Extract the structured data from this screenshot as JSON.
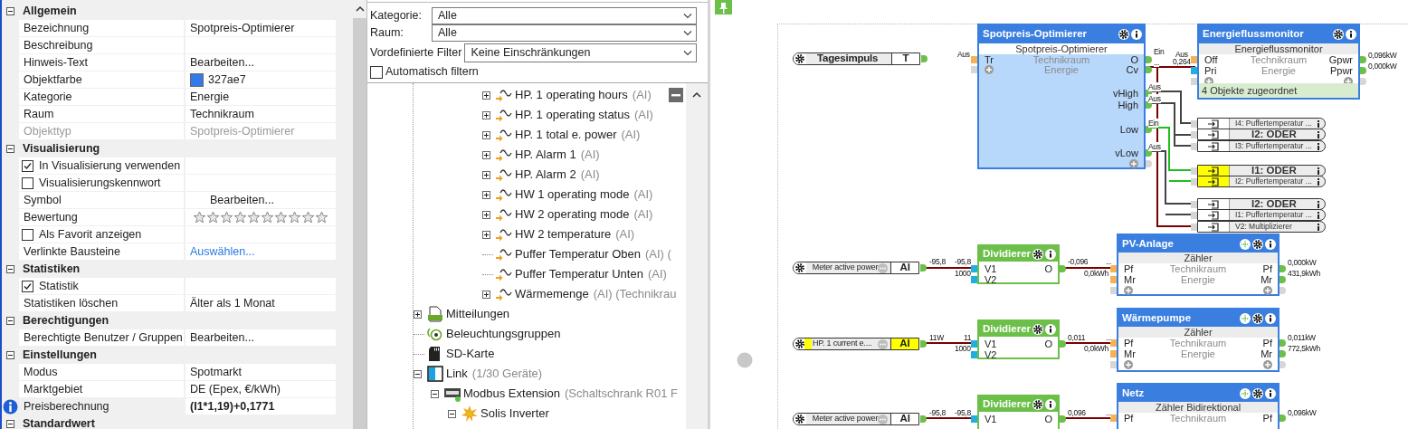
{
  "properties": {
    "sections": [
      {
        "title": "Allgemein",
        "expanded": true,
        "rows": [
          {
            "kind": "text",
            "label": "Bezeichnung",
            "value": "Spotpreis-Optimierer",
            "disabled": false
          },
          {
            "kind": "text",
            "label": "Beschreibung",
            "disabled": false
          },
          {
            "kind": "text",
            "label": "Hinweis-Text",
            "value": "Bearbeiten...",
            "disabled": false
          },
          {
            "kind": "color",
            "label": "Objektfarbe",
            "value": "327ae7",
            "color": "#327ae7",
            "disabled": false
          },
          {
            "kind": "text",
            "label": "Kategorie",
            "value": "Energie",
            "disabled": false
          },
          {
            "kind": "text",
            "label": "Raum",
            "value": "Technikraum",
            "disabled": false
          },
          {
            "kind": "text",
            "label": "Objekttyp",
            "value": "Spotpreis-Optimierer",
            "disabled": true
          }
        ]
      },
      {
        "title": "Visualisierung",
        "expanded": true,
        "rows": [
          {
            "kind": "check",
            "label": "In Visualisierung verwenden",
            "checked": true,
            "disabled": false
          },
          {
            "kind": "check",
            "label": "Visualisierungskennwort",
            "checked": false,
            "disabled": false
          },
          {
            "kind": "symbol",
            "label": "Symbol",
            "value": "Bearbeiten...",
            "disabled": false
          },
          {
            "kind": "stars",
            "label": "Bewertung",
            "stars": 0,
            "disabled": false
          },
          {
            "kind": "check",
            "label": "Als Favorit anzeigen",
            "checked": false,
            "disabled": false
          },
          {
            "kind": "link",
            "label": "Verlinkte Bausteine",
            "value": "Auswählen...",
            "disabled": false
          }
        ]
      },
      {
        "title": "Statistiken",
        "expanded": true,
        "rows": [
          {
            "kind": "check",
            "label": "Statistik",
            "checked": true,
            "disabled": false
          },
          {
            "kind": "text",
            "label": "Statistiken löschen",
            "value": "Älter als 1 Monat",
            "disabled": false
          }
        ]
      },
      {
        "title": "Berechtigungen",
        "expanded": true,
        "rows": [
          {
            "kind": "text",
            "label": "Berechtigte Benutzer / Gruppen",
            "value": "Bearbeiten...",
            "disabled": false
          }
        ]
      },
      {
        "title": "Einstellungen",
        "expanded": true,
        "rows": [
          {
            "kind": "text",
            "label": "Modus",
            "value": "Spotmarkt",
            "disabled": false
          },
          {
            "kind": "text",
            "label": "Marktgebiet",
            "value": "DE (Epex, €/kWh)",
            "disabled": false
          },
          {
            "kind": "formula",
            "label": "Preisberechnung",
            "value": "(I1*1,19)+0,1771",
            "disabled": false
          }
        ]
      },
      {
        "title": "Standardwert",
        "expanded": true
      }
    ]
  },
  "filter": {
    "category": {
      "label": "Kategorie:",
      "value": "Alle"
    },
    "room": {
      "label": "Raum:",
      "value": "Alle"
    },
    "preset": {
      "label": "Vordefinierte Filter",
      "value": "Keine Einschränkungen"
    },
    "auto_filter": {
      "label": "Automatisch filtern",
      "checked": false
    }
  },
  "tree": {
    "items": [
      {
        "kind": "continuation",
        "children": [
          {
            "kind": "continuation",
            "children": [
              {
                "kind": "continuation",
                "children": [
                  {
                    "kind": "continuation",
                    "children": [
                      {
                        "kind": "analog",
                        "label": "HP. 1 operating hours",
                        "suffix": "(AI)",
                        "expanded": false
                      },
                      {
                        "kind": "analog",
                        "label": "HP. 1 operating status",
                        "suffix": "(AI)",
                        "expanded": false
                      },
                      {
                        "kind": "analog",
                        "label": "HP. 1 total e. power",
                        "suffix": "(AI)",
                        "expanded": false
                      },
                      {
                        "kind": "analog",
                        "label": "HP. Alarm 1",
                        "suffix": "(AI)",
                        "expanded": false
                      },
                      {
                        "kind": "analog",
                        "label": "HP. Alarm 2",
                        "suffix": "(AI)",
                        "expanded": false
                      },
                      {
                        "kind": "analog",
                        "label": "HW 1 operating mode",
                        "suffix": "(AI)",
                        "expanded": false
                      },
                      {
                        "kind": "analog",
                        "label": "HW 2 operating mode",
                        "suffix": "(AI)",
                        "expanded": false
                      },
                      {
                        "kind": "analog",
                        "label": "HW 2 temperature",
                        "suffix": "(AI)",
                        "expanded": false
                      },
                      {
                        "kind": "analog",
                        "label": "Puffer Temperatur Oben",
                        "suffix": "(AI) ("
                      },
                      {
                        "kind": "analog",
                        "label": "Puffer Temperatur Unten",
                        "suffix": "(AI)"
                      },
                      {
                        "kind": "analog",
                        "label": "Wärmemenge",
                        "suffix": "(AI) (Technikrau",
                        "expanded": false
                      }
                    ]
                  }
                ]
              }
            ]
          }
        ]
      },
      {
        "kind": "log",
        "label": "Mitteilungen",
        "expanded": false
      },
      {
        "kind": "light",
        "label": "Beleuchtungsgruppen"
      },
      {
        "kind": "sd",
        "label": "SD-Karte"
      },
      {
        "kind": "link",
        "label": "Link",
        "suffix": "(1/30 Geräte)",
        "expanded": true,
        "children": [
          {
            "kind": "modbus",
            "label": "Modbus Extension",
            "suffix": "(Schaltschrank R01 F",
            "expanded": true,
            "children": [
              {
                "kind": "inverter",
                "label": "Solis Inverter",
                "expanded": true
              }
            ]
          }
        ]
      }
    ]
  },
  "canvas": {
    "inputs": [
      {
        "label": "Tagesimpuls",
        "type_label": "T",
        "has_options": false,
        "highlighted": false
      },
      {
        "label": "Meter active power",
        "type_label": "AI",
        "has_options": true,
        "highlighted": false
      },
      {
        "label": "HP. 1 current e....",
        "type_label": "AI",
        "has_options": true,
        "highlighted": true
      },
      {
        "label": "Meter active power",
        "type_label": "AI",
        "has_options": true,
        "highlighted": false
      }
    ],
    "blocks": [
      {
        "kind": "optimizer",
        "title": "Spotpreis-Optimierer",
        "subtitle": "Spotpreis-Optimierer",
        "rows": [
          {
            "left": "Tr",
            "center": "Technikraum",
            "right": "O",
            "input": {
              "kind": "trigger"
            },
            "output": {
              "kind": "value"
            }
          },
          {
            "input": {
              "kind": "add"
            },
            "center": "Energie",
            "right": "Cv",
            "output": {
              "kind": "value"
            }
          },
          {
            "right": "vHigh",
            "output": {
              "kind": "value"
            }
          },
          {
            "right": "High",
            "output": {
              "kind": "value"
            }
          },
          {
            "right": "Low",
            "output": {
              "kind": "value"
            }
          },
          {
            "right": "vLow",
            "output": {
              "kind": "value"
            }
          },
          {
            "output": {
              "kind": "add"
            }
          }
        ]
      },
      {
        "kind": "monitor",
        "title": "Energieflussmonitor",
        "subtitle": "Energieflussmonitor",
        "footer": "4 Objekte zugeordnet",
        "rows": [
          {
            "left": "Off",
            "center": "Technikraum",
            "right": "Gpwr",
            "input": {
              "kind": "trigger"
            },
            "output": {
              "kind": "value"
            }
          },
          {
            "left": "Pri",
            "center": "Energie",
            "right": "Ppwr",
            "input": {
              "kind": "value"
            },
            "output": {
              "kind": "value"
            }
          },
          {
            "input": {
              "kind": "add"
            },
            "output": {
              "kind": "add"
            }
          }
        ]
      },
      {
        "kind": "divider",
        "title": "Dividierer",
        "rows": [
          {
            "left": "V1",
            "right": "O",
            "input": {
              "kind": "value"
            },
            "output": {
              "kind": "value"
            }
          },
          {
            "left": "V2",
            "input": {
              "kind": "value"
            }
          }
        ]
      },
      {
        "kind": "meter",
        "title": "PV-Anlage",
        "subtitle": "Zähler",
        "rows": [
          {
            "left": "Pf",
            "center": "Technikraum",
            "right": "Pf",
            "input": {
              "kind": "trigger"
            },
            "output": {
              "kind": "value"
            }
          },
          {
            "left": "Mr",
            "center": "Energie",
            "right": "Mr",
            "input": {
              "kind": "trigger"
            },
            "output": {
              "kind": "value"
            }
          },
          {
            "input": {
              "kind": "add"
            },
            "output": {
              "kind": "add"
            }
          }
        ]
      },
      {
        "kind": "divider",
        "title": "Dividierer",
        "rows": [
          {
            "left": "V1",
            "right": "O",
            "input": {
              "kind": "value"
            },
            "output": {
              "kind": "value"
            }
          },
          {
            "left": "V2",
            "input": {
              "kind": "value"
            }
          }
        ]
      },
      {
        "kind": "meter",
        "title": "Wärmepumpe",
        "subtitle": "Zähler",
        "rows": [
          {
            "left": "Pf",
            "center": "Technikraum",
            "right": "Pf",
            "input": {
              "kind": "trigger"
            },
            "output": {
              "kind": "value"
            }
          },
          {
            "left": "Mr",
            "center": "Energie",
            "right": "Mr",
            "input": {
              "kind": "trigger"
            },
            "output": {
              "kind": "value"
            }
          },
          {
            "input": {
              "kind": "add"
            },
            "output": {
              "kind": "add"
            }
          }
        ]
      },
      {
        "kind": "divider",
        "title": "Dividierer",
        "rows": [
          {
            "left": "V1",
            "right": "O",
            "input": {
              "kind": "value"
            },
            "output": {
              "kind": "value"
            }
          }
        ]
      },
      {
        "kind": "meter",
        "title": "Netz",
        "subtitle": "Zähler Bidirektional",
        "rows": [
          {
            "left": "Pf",
            "center": "Technikraum",
            "right": "Pf",
            "input": {
              "kind": "trigger"
            },
            "output": {
              "kind": "value"
            }
          }
        ]
      }
    ],
    "references": [
      {
        "label": "I4: Puffertemperatur ...",
        "kind": "signal",
        "highlighted": false
      },
      {
        "label": "I2: ODER",
        "kind": "gate",
        "highlighted": false
      },
      {
        "label": "I3: Puffertemperatur ...",
        "kind": "signal",
        "highlighted": false
      },
      {
        "label": "I1: ODER",
        "kind": "gate",
        "highlighted": true
      },
      {
        "label": "I2: Puffertemperatur ...",
        "kind": "signal",
        "highlighted": true
      },
      {
        "label": "I2: ODER",
        "kind": "gate",
        "highlighted": false
      },
      {
        "label": "I1: Puffertemperatur ...",
        "kind": "signal",
        "highlighted": false
      },
      {
        "label": "V2: Multiplizierer",
        "kind": "signal",
        "highlighted": false
      }
    ],
    "value_labels": [
      "Aus",
      "Ein",
      "Aus",
      "...",
      "0,264",
      "Aus",
      "Aus",
      "Ein",
      "Aus",
      "0,096kW",
      "0,000kW",
      "-95,8",
      "-95,8",
      "1000",
      "-0,096",
      "...",
      "0,0kWh",
      "0,000kW",
      "431,9kWh",
      "11W",
      "11",
      "1000",
      "0,011",
      "...",
      "0,0kWh",
      "0,011kW",
      "772,5kWh",
      "-95,8",
      "-95,8",
      "0,096",
      "...",
      "0,096kW"
    ]
  }
}
